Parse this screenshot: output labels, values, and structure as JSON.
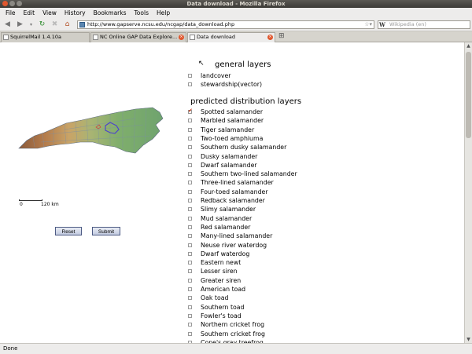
{
  "window": {
    "title": "Data download - Mozilla Firefox"
  },
  "menu": [
    "File",
    "Edit",
    "View",
    "History",
    "Bookmarks",
    "Tools",
    "Help"
  ],
  "nav": {
    "url": "http://www.gapserve.ncsu.edu/ncgap/data_download.php",
    "search_placeholder": "Wikipedia (en)",
    "search_engine": "W"
  },
  "tabs": [
    {
      "label": "SquirrelMail 1.4.10a",
      "active": false
    },
    {
      "label": "NC Online GAP Data Explore...",
      "active": false
    },
    {
      "label": "Data download",
      "active": true
    }
  ],
  "page": {
    "general_heading": "general layers",
    "general_layers": [
      {
        "label": "landcover",
        "checked": false
      },
      {
        "label": "stewardship(vector)",
        "checked": false
      }
    ],
    "predicted_heading": "predicted distribution layers",
    "predicted_layers": [
      {
        "label": "Spotted salamander",
        "checked": true
      },
      {
        "label": "Marbled salamander",
        "checked": false
      },
      {
        "label": "Tiger salamander",
        "checked": false
      },
      {
        "label": "Two-toed amphiuma",
        "checked": false
      },
      {
        "label": "Southern dusky salamander",
        "checked": false
      },
      {
        "label": "Dusky salamander",
        "checked": false
      },
      {
        "label": "Dwarf salamander",
        "checked": false
      },
      {
        "label": "Southern two-lined salamander",
        "checked": false
      },
      {
        "label": "Three-lined salamander",
        "checked": false
      },
      {
        "label": "Four-toed salamander",
        "checked": false
      },
      {
        "label": "Redback salamander",
        "checked": false
      },
      {
        "label": "Slimy salamander",
        "checked": false
      },
      {
        "label": "Mud salamander",
        "checked": false
      },
      {
        "label": "Red salamander",
        "checked": false
      },
      {
        "label": "Many-lined salamander",
        "checked": false
      },
      {
        "label": "Neuse river waterdog",
        "checked": false
      },
      {
        "label": "Dwarf waterdog",
        "checked": false
      },
      {
        "label": "Eastern newt",
        "checked": false
      },
      {
        "label": "Lesser siren",
        "checked": false
      },
      {
        "label": "Greater siren",
        "checked": false
      },
      {
        "label": "American toad",
        "checked": false
      },
      {
        "label": "Oak toad",
        "checked": false
      },
      {
        "label": "Southern toad",
        "checked": false
      },
      {
        "label": "Fowler's toad",
        "checked": false
      },
      {
        "label": "Northern cricket frog",
        "checked": false
      },
      {
        "label": "Southern cricket frog",
        "checked": false
      },
      {
        "label": "Cope's gray treefrog",
        "checked": false
      }
    ],
    "scale": {
      "start": "0",
      "end": "120 km"
    },
    "reset_label": "Reset",
    "submit_label": "Submit"
  },
  "status": "Done"
}
